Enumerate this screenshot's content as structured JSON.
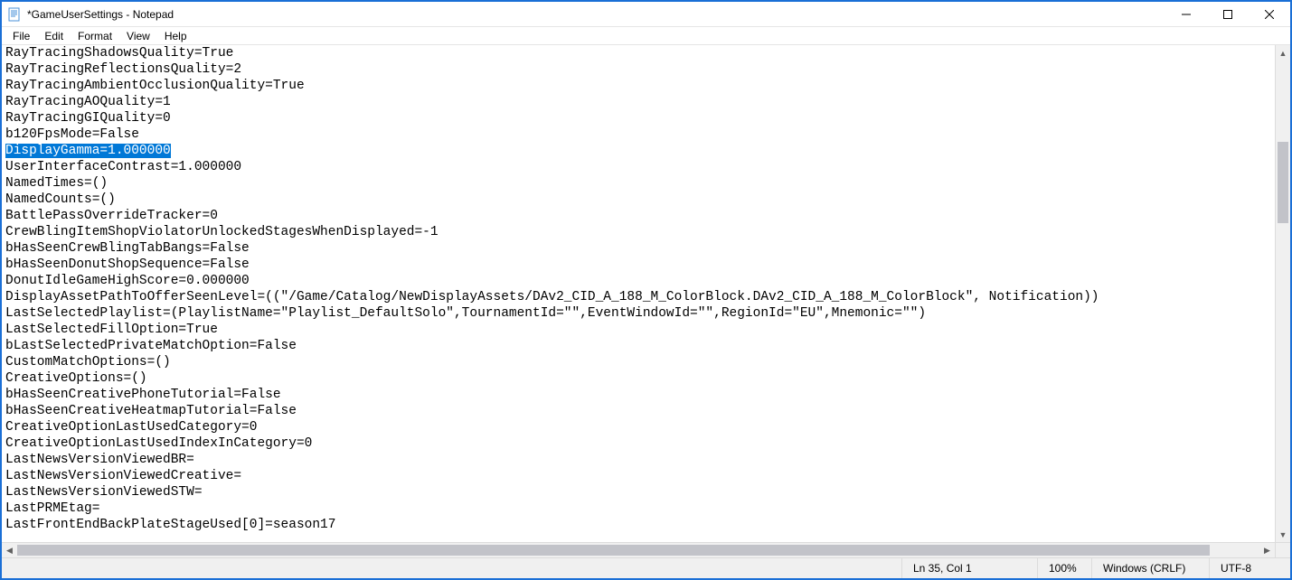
{
  "titlebar": {
    "title": "*GameUserSettings - Notepad"
  },
  "menu": {
    "file": "File",
    "edit": "Edit",
    "format": "Format",
    "view": "View",
    "help": "Help"
  },
  "editor": {
    "selected_line_index": 6,
    "lines": [
      "RayTracingShadowsQuality=True",
      "RayTracingReflectionsQuality=2",
      "RayTracingAmbientOcclusionQuality=True",
      "RayTracingAOQuality=1",
      "RayTracingGIQuality=0",
      "b120FpsMode=False",
      "DisplayGamma=1.000000",
      "UserInterfaceContrast=1.000000",
      "NamedTimes=()",
      "NamedCounts=()",
      "BattlePassOverrideTracker=0",
      "CrewBlingItemShopViolatorUnlockedStagesWhenDisplayed=-1",
      "bHasSeenCrewBlingTabBangs=False",
      "bHasSeenDonutShopSequence=False",
      "DonutIdleGameHighScore=0.000000",
      "DisplayAssetPathToOfferSeenLevel=((\"/Game/Catalog/NewDisplayAssets/DAv2_CID_A_188_M_ColorBlock.DAv2_CID_A_188_M_ColorBlock\", Notification))",
      "LastSelectedPlaylist=(PlaylistName=\"Playlist_DefaultSolo\",TournamentId=\"\",EventWindowId=\"\",RegionId=\"EU\",Mnemonic=\"\")",
      "LastSelectedFillOption=True",
      "bLastSelectedPrivateMatchOption=False",
      "CustomMatchOptions=()",
      "CreativeOptions=()",
      "bHasSeenCreativePhoneTutorial=False",
      "bHasSeenCreativeHeatmapTutorial=False",
      "CreativeOptionLastUsedCategory=0",
      "CreativeOptionLastUsedIndexInCategory=0",
      "LastNewsVersionViewedBR=",
      "LastNewsVersionViewedCreative=",
      "LastNewsVersionViewedSTW=",
      "LastPRMEtag=",
      "LastFrontEndBackPlateStageUsed[0]=season17"
    ]
  },
  "statusbar": {
    "position": "Ln 35, Col 1",
    "zoom": "100%",
    "eol": "Windows (CRLF)",
    "encoding": "UTF-8"
  }
}
